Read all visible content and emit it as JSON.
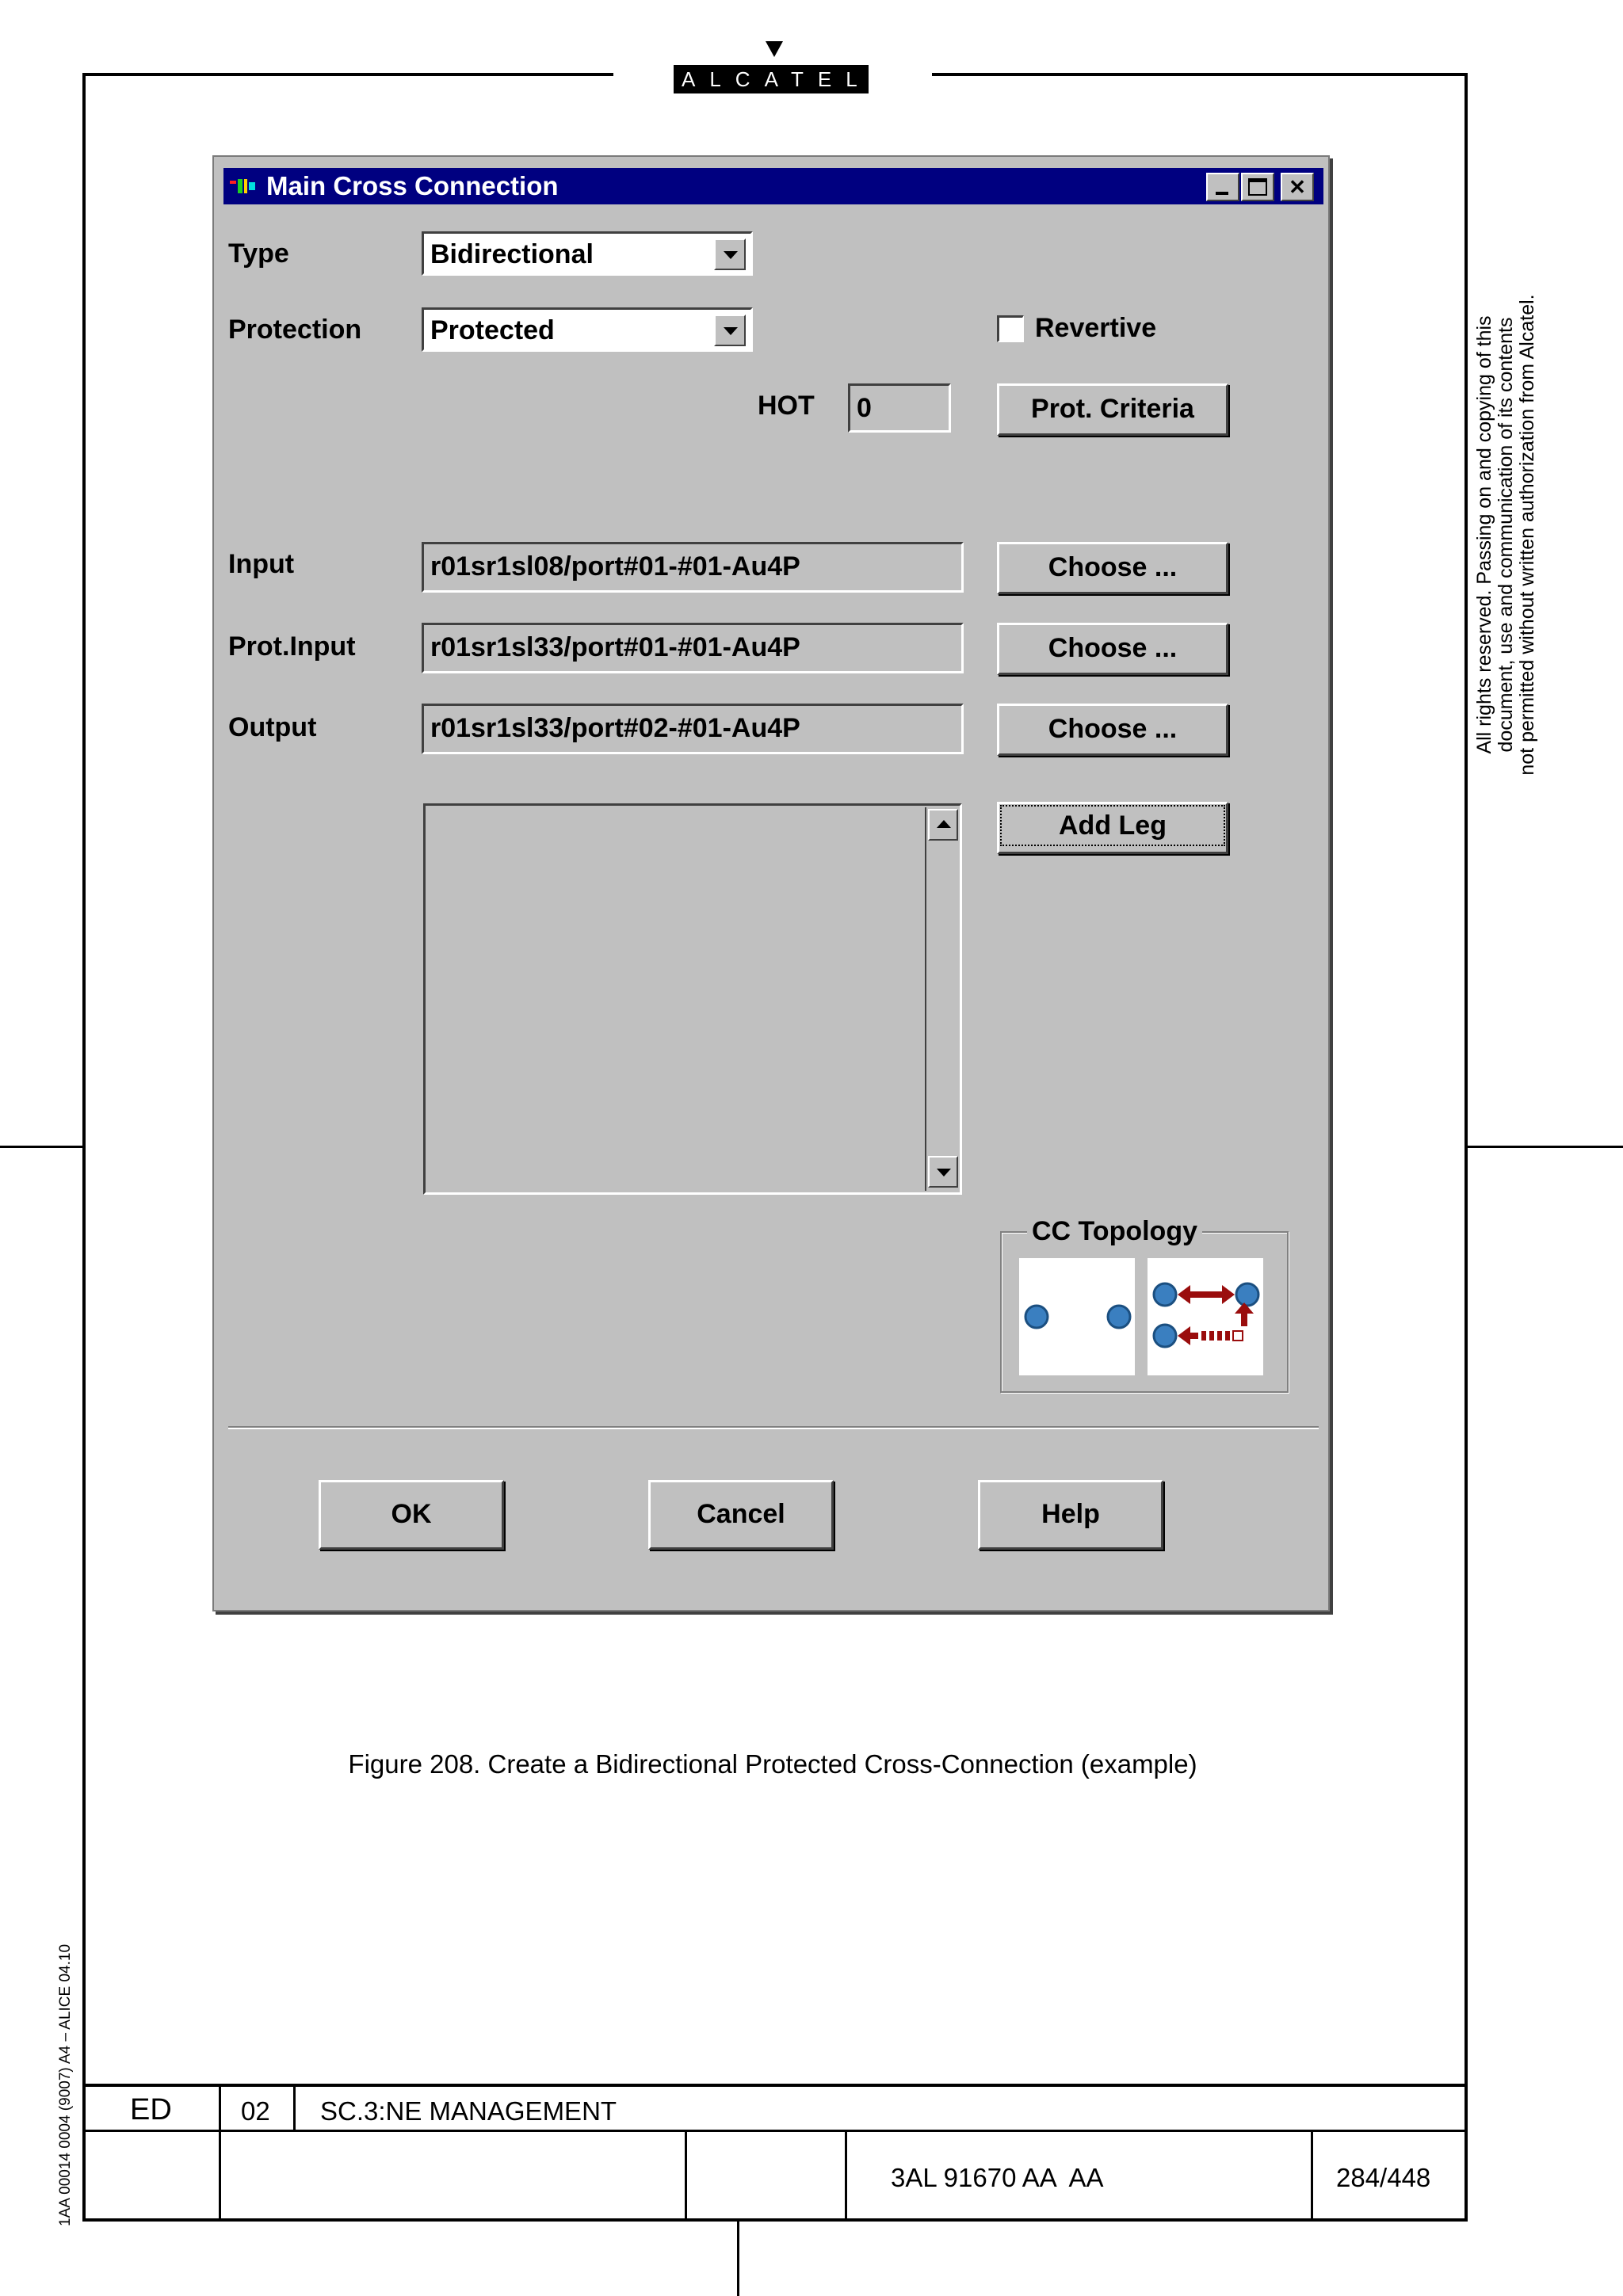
{
  "logo": "ALCATEL",
  "rights_notice": [
    "All rights reserved. Passing on and copying of this",
    "document, use and communication of its contents",
    "not permitted without written authorization from Alcatel."
  ],
  "form_code": "1AA 00014 0004 (9007) A4 – ALICE 04.10",
  "dialog": {
    "title": "Main Cross Connection",
    "type_label": "Type",
    "type_value": "Bidirectional",
    "protection_label": "Protection",
    "protection_value": "Protected",
    "revertive_label": "Revertive",
    "revertive_checked": false,
    "hot_label": "HOT",
    "hot_value": "0",
    "prot_criteria_label": "Prot. Criteria",
    "input_label": "Input",
    "input_value": "r01sr1sl08/port#01-#01-Au4P",
    "prot_input_label": "Prot.Input",
    "prot_input_value": "r01sr1sl33/port#01-#01-Au4P",
    "output_label": "Output",
    "output_value": "r01sr1sl33/port#02-#01-Au4P",
    "choose_label": "Choose ...",
    "add_leg_label": "Add Leg",
    "topology_label": "CC Topology",
    "ok_label": "OK",
    "cancel_label": "Cancel",
    "help_label": "Help"
  },
  "caption": "Figure 208. Create a Bidirectional Protected Cross-Connection (example)",
  "footer": {
    "ed_label": "ED",
    "ed_value": "02",
    "section": "SC.3:NE MANAGEMENT",
    "doc_number": "3AL 91670 AA  AA",
    "page": "284/448"
  }
}
